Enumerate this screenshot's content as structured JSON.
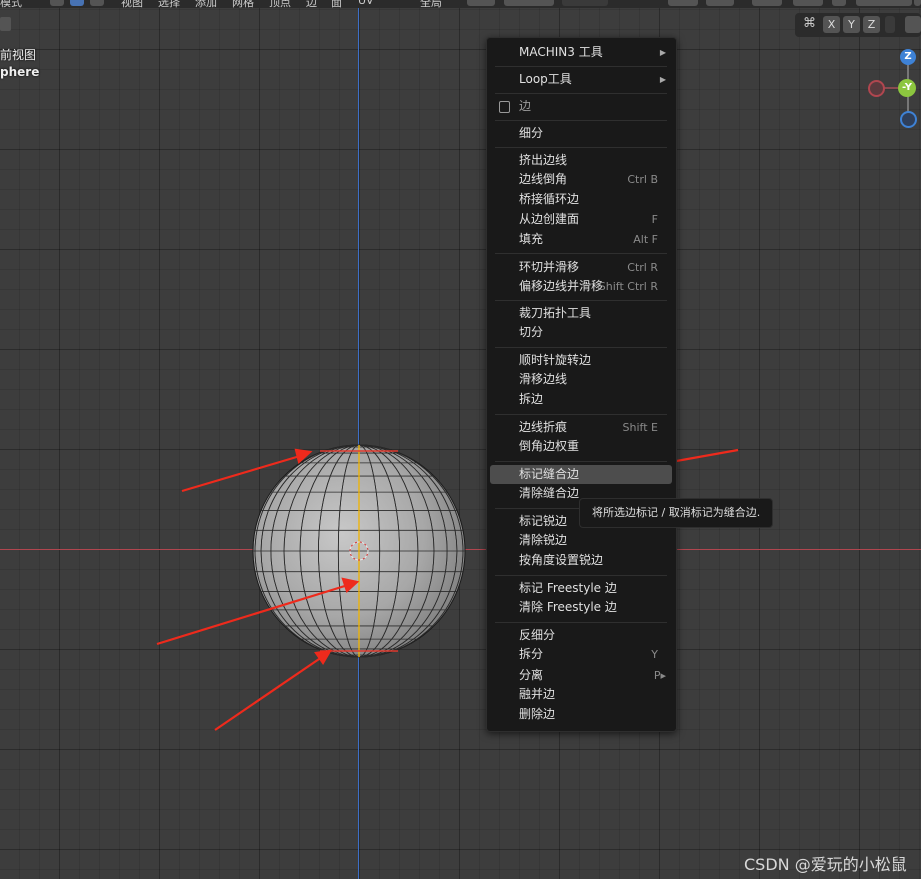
{
  "header": {
    "items": [
      "模式",
      "视图",
      "选择",
      "添加",
      "网格",
      "顶点",
      "边",
      "面",
      "UV",
      "全局"
    ]
  },
  "viewport": {
    "view_title": "前视图",
    "object_name": "phere",
    "axis_buttons": [
      "X",
      "Y",
      "Z"
    ],
    "gizmo": {
      "z": "Z",
      "y": "-Y"
    },
    "colors": {
      "x_axis": "#b0464f",
      "y_axis": "#3d6fc7",
      "gizmo_z": "#3e82d6",
      "gizmo_y": "#8cc63f",
      "gizmo_x_neg": "#b0464f",
      "seam": "#e03a2f"
    }
  },
  "menu": {
    "items": [
      {
        "label": "MACHIN3 工具",
        "submenu": true
      },
      {
        "label": "Loop工具",
        "submenu": true
      },
      {
        "label": "边",
        "header": true
      },
      {
        "label": "细分"
      },
      {
        "label": "挤出边线"
      },
      {
        "label": "边线倒角",
        "shortcut": "Ctrl B"
      },
      {
        "label": "桥接循环边"
      },
      {
        "label": "从边创建面",
        "shortcut": "F"
      },
      {
        "label": "填充",
        "shortcut": "Alt F"
      },
      {
        "label": "环切并滑移",
        "shortcut": "Ctrl R"
      },
      {
        "label": "偏移边线并滑移",
        "shortcut": "Shift Ctrl R"
      },
      {
        "label": "裁刀拓扑工具"
      },
      {
        "label": "切分"
      },
      {
        "label": "顺时针旋转边"
      },
      {
        "label": "滑移边线"
      },
      {
        "label": "拆边"
      },
      {
        "label": "边线折痕",
        "shortcut": "Shift E"
      },
      {
        "label": "倒角边权重"
      },
      {
        "label": "标记缝合边",
        "highlighted": true
      },
      {
        "label": "清除缝合边"
      },
      {
        "label": "标记锐边"
      },
      {
        "label": "清除锐边"
      },
      {
        "label": "按角度设置锐边"
      },
      {
        "label": "标记 Freestyle 边"
      },
      {
        "label": "清除 Freestyle 边"
      },
      {
        "label": "反细分"
      },
      {
        "label": "拆分",
        "shortcut": "Y"
      },
      {
        "label": "分离",
        "shortcut": "P▸"
      },
      {
        "label": "融并边"
      },
      {
        "label": "删除边"
      }
    ]
  },
  "tooltip": {
    "text": "将所选边标记 / 取消标记为缝合边."
  },
  "watermark": {
    "text": "CSDN @爱玩的小松鼠"
  }
}
